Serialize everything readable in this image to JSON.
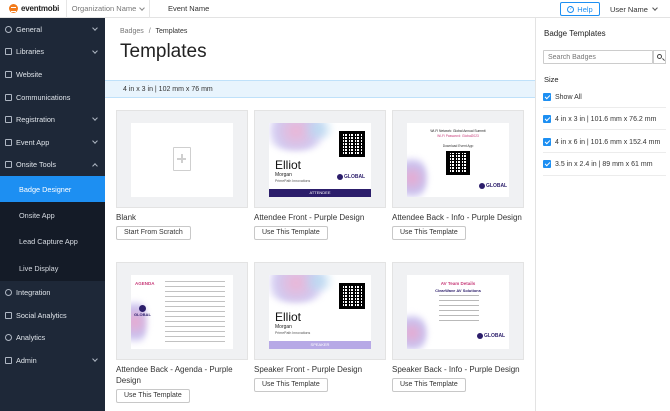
{
  "topbar": {
    "brand": "eventmobi",
    "organization": "Organization Name",
    "event": "Event Name",
    "help": "Help",
    "user": "User Name"
  },
  "sidebar": {
    "items": [
      {
        "label": "General",
        "icon": "globe-icon"
      },
      {
        "label": "Libraries",
        "icon": "book-icon"
      },
      {
        "label": "Website",
        "icon": "monitor-icon"
      },
      {
        "label": "Communications",
        "icon": "envelope-icon"
      },
      {
        "label": "Registration",
        "icon": "tag-icon"
      },
      {
        "label": "Event App",
        "icon": "phone-icon"
      },
      {
        "label": "Onsite Tools",
        "icon": "tablet-icon"
      }
    ],
    "sub_items": [
      "Badge Designer",
      "Onsite App",
      "Lead Capture App",
      "Live Display"
    ],
    "items_after": [
      {
        "label": "Integration",
        "icon": "link-icon"
      },
      {
        "label": "Social Analytics",
        "icon": "megaphone-icon"
      },
      {
        "label": "Analytics",
        "icon": "chart-icon"
      },
      {
        "label": "Admin",
        "icon": "wrench-icon"
      }
    ]
  },
  "main": {
    "breadcrumb": {
      "parent": "Badges",
      "separator": "/",
      "current": "Templates"
    },
    "title": "Templates",
    "size_strip": "4 in x 3 in  |  102 mm x 76 mm",
    "cards": [
      {
        "title": "Blank",
        "button": "Start From Scratch"
      },
      {
        "title": "Attendee Front - Purple Design",
        "button": "Use This Template"
      },
      {
        "title": "Attendee Back - Info - Purple Design",
        "button": "Use This Template"
      },
      {
        "title": "Attendee Back - Agenda - Purple Design",
        "button": "Use This Template"
      },
      {
        "title": "Speaker Front - Purple Design",
        "button": "Use This Template"
      },
      {
        "title": "Speaker Back - Info - Purple Design",
        "button": "Use This Template"
      }
    ],
    "badge_front_attendee": {
      "name": "Elliot",
      "surname": "Morgan",
      "company": "PrimePath Innovations",
      "role": "ATTENDEE"
    },
    "badge_front_speaker": {
      "name": "Elliot",
      "surname": "Morgan",
      "company": "PrimePath Innovations",
      "role": "SPEAKER"
    },
    "badge_back_info": {
      "line1": "Wi-Fi Network: Global Annual Summit",
      "line2": "Wi-Fi Password: Global2023",
      "line3": "Download Event App",
      "logo": "GLOBAL"
    },
    "badge_back_agenda": {
      "heading": "AGENDA",
      "logo": "GLOBAL"
    },
    "badge_back_speaker": {
      "heading": "AV Team Details",
      "sub": "ClearWave AV Solutions",
      "logo": "GLOBAL"
    }
  },
  "panel": {
    "title": "Badge Templates",
    "search_placeholder": "Search Badges",
    "size_label": "Size",
    "options": [
      "Show All",
      "4 in x 3 in  |  101.6 mm x 76.2 mm",
      "4 in x 6 in  |  101.6 mm x 152.4 mm",
      "3.5 in x 2.4 in  |  89 mm x 61 mm"
    ]
  },
  "colors": {
    "accent": "#1d8ff2",
    "sidebar": "#1e2838",
    "badge_purple": "#2c1e6b"
  }
}
